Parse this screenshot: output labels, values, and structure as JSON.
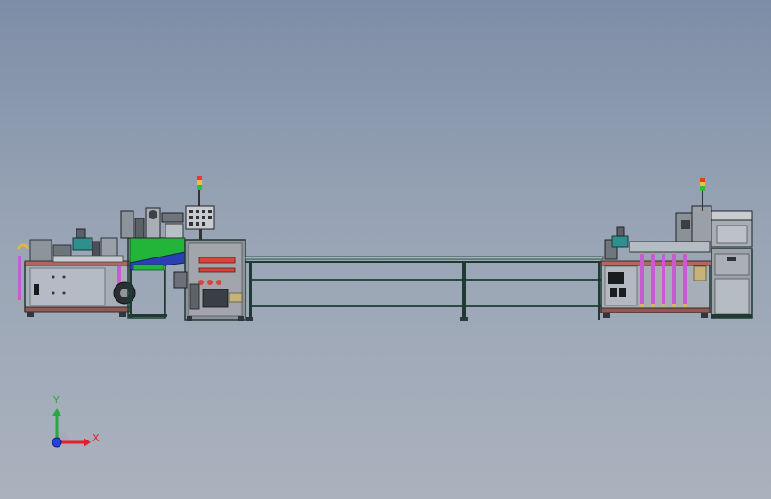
{
  "triad": {
    "x_label": "X",
    "y_label": "Y",
    "x_color": "#e0202a",
    "y_color": "#2aa845",
    "z_color": "#2840d8"
  },
  "colors": {
    "background_top": "#7e8da7",
    "background_bottom": "#aab2bd",
    "frame_outline": "#1e3a32",
    "green_chute": "#23b53a",
    "magenta_tubes": "#c85ad2",
    "stack_light": [
      "#e53b2a",
      "#e8c23a",
      "#3bb54a"
    ]
  }
}
